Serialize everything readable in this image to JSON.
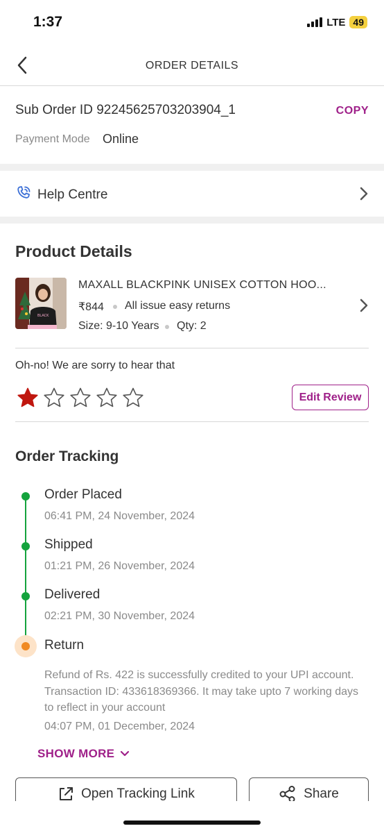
{
  "status_bar": {
    "time": "1:37",
    "network": "LTE",
    "battery": "49"
  },
  "header": {
    "title": "ORDER DETAILS",
    "back_icon": "chevron-left-icon"
  },
  "suborder": {
    "id_text": "Sub Order ID 92245625703203904_1",
    "copy_label": "COPY",
    "payment_label": "Payment Mode",
    "payment_value": "Online"
  },
  "help": {
    "label": "Help Centre",
    "icon": "phone-support-icon"
  },
  "product": {
    "section_title": "Product Details",
    "name": "MAXALL BLACKPINK UNISEX COTTON HOO...",
    "price": "₹844",
    "returns": "All issue easy returns",
    "size": "Size: 9-10 Years",
    "qty": "Qty: 2"
  },
  "review": {
    "message": "Oh-no! We are sorry to hear that",
    "rating": 1,
    "max_rating": 5,
    "edit_label": "Edit Review",
    "star_color": "#c0170f"
  },
  "tracking": {
    "title": "Order Tracking",
    "steps": [
      {
        "title": "Order Placed",
        "time": "06:41 PM, 24 November, 2024"
      },
      {
        "title": "Shipped",
        "time": "01:21 PM, 26 November, 2024"
      },
      {
        "title": "Delivered",
        "time": "02:21 PM, 30 November, 2024"
      },
      {
        "title": "Return",
        "detail": "Refund of Rs. 422 is successfully credited to your UPI account. Transaction ID: 433618369366. It may take upto 7 working days to reflect in your account",
        "time": "04:07 PM, 01 December, 2024"
      }
    ],
    "show_more": "SHOW MORE"
  },
  "actions": {
    "open_tracking": "Open Tracking Link",
    "share": "Share"
  },
  "colors": {
    "accent": "#9f2089",
    "success": "#14a33d",
    "return": "#f08a24"
  }
}
